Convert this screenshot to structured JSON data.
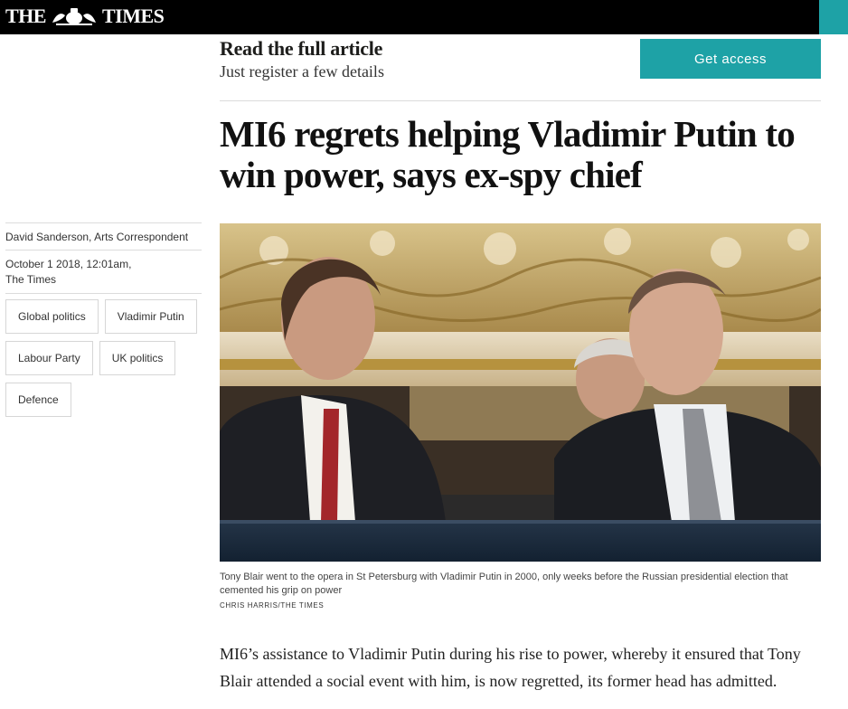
{
  "header": {
    "logo_left": "THE",
    "logo_right": "TIMES",
    "crest_icon": "royal-crest-icon",
    "accent_color": "#1ea2a6"
  },
  "register": {
    "title": "Read the full article",
    "subtitle": "Just register a few details",
    "button_label": "Get access"
  },
  "article": {
    "headline": "MI6 regrets helping Vladimir Putin to win power, says ex-spy chief",
    "byline": "David Sanderson, Arts Correspondent",
    "date": "October 1 2018, 12:01am,",
    "publication": "The Times",
    "tags": [
      "Global politics",
      "Vladimir Putin",
      "Labour Party",
      "UK politics",
      "Defence"
    ],
    "image": {
      "caption": "Tony Blair went to the opera in St Petersburg with Vladimir Putin in 2000, only weeks before the Russian presidential election that cemented his grip on power",
      "credit": "CHRIS HARRIS/THE TIMES"
    },
    "body": "MI6’s assistance to Vladimir Putin during his rise to power, whereby it ensured that Tony Blair attended a social event with him, is now regretted, its former head has admitted."
  }
}
